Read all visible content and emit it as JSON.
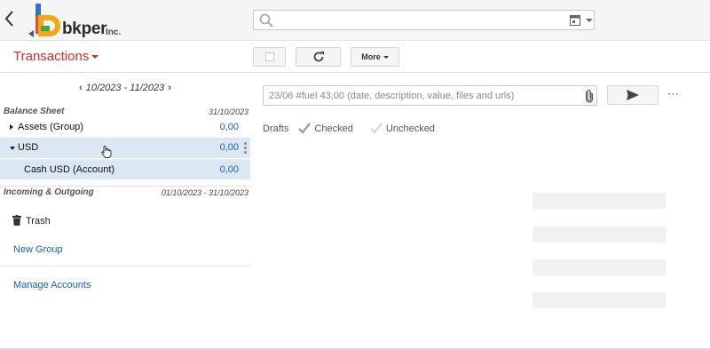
{
  "app": {
    "logo_text": "bkper",
    "logo_suffix": "Inc.",
    "colors": {
      "accent_red": "#c9302c",
      "link_blue": "#1a5fb4",
      "selection": "#dbe7f2"
    }
  },
  "header": {
    "search_placeholder": "",
    "icons": [
      "back-icon",
      "search-icon",
      "calendar-icon",
      "chevron-down-icon"
    ]
  },
  "toolbar": {
    "book_menu_label": "Transactions",
    "more_label": "More"
  },
  "sidebar": {
    "period": "10/2023 - 11/2023",
    "balance_sheet": {
      "title": "Balance Sheet",
      "date": "31/10/2023"
    },
    "rows": [
      {
        "label": "Assets (Group)",
        "value": "0,00"
      },
      {
        "label": "USD",
        "value": "0,00"
      },
      {
        "label": "Cash USD (Account)",
        "value": "0,00"
      }
    ],
    "incoming_outgoing": {
      "title": "Incoming & Outgoing",
      "date": "01/10/2023 - 31/10/2023"
    },
    "trash_label": "Trash",
    "new_group_label": "New Group",
    "manage_accounts_label": "Manage Accounts"
  },
  "main": {
    "entry_placeholder": "23/06 #fuel 43,00 (date, description, value, files and urls)",
    "filters": {
      "drafts": "Drafts",
      "checked": "Checked",
      "unchecked": "Unchecked"
    }
  }
}
